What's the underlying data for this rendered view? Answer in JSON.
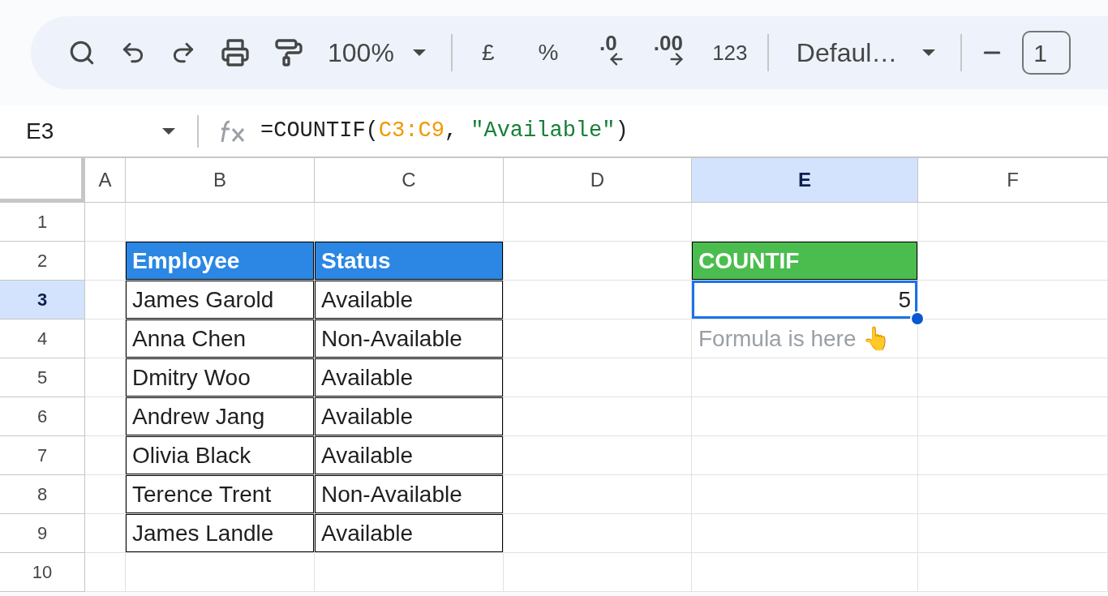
{
  "toolbar": {
    "zoom": "100%",
    "currency": "£",
    "percent": "%",
    "decrease_decimal": ".0",
    "increase_decimal": ".00",
    "more_formats": "123",
    "font": "Defaul…",
    "font_size": "1"
  },
  "formula_bar": {
    "cell_ref": "E3",
    "segments": [
      {
        "kind": "plain",
        "text": "=COUNTIF("
      },
      {
        "kind": "range",
        "text": "C3:C9"
      },
      {
        "kind": "plain",
        "text": ", "
      },
      {
        "kind": "string",
        "text": "\"Available\""
      },
      {
        "kind": "plain",
        "text": ")"
      }
    ]
  },
  "columns": [
    {
      "label": "A",
      "selected": false
    },
    {
      "label": "B",
      "selected": false
    },
    {
      "label": "C",
      "selected": false
    },
    {
      "label": "D",
      "selected": false
    },
    {
      "label": "E",
      "selected": true
    },
    {
      "label": "F",
      "selected": false
    }
  ],
  "row_headers": [
    {
      "label": "1",
      "selected": false
    },
    {
      "label": "2",
      "selected": false
    },
    {
      "label": "3",
      "selected": true
    },
    {
      "label": "4",
      "selected": false
    },
    {
      "label": "5",
      "selected": false
    },
    {
      "label": "6",
      "selected": false
    },
    {
      "label": "7",
      "selected": false
    },
    {
      "label": "8",
      "selected": false
    },
    {
      "label": "9",
      "selected": false
    },
    {
      "label": "10",
      "selected": false
    }
  ],
  "employee_table": {
    "headers": [
      "Employee",
      "Status"
    ],
    "rows": [
      {
        "employee": "James Garold",
        "status": "Available"
      },
      {
        "employee": "Anna Chen",
        "status": "Non-Available"
      },
      {
        "employee": "Dmitry Woo",
        "status": "Available"
      },
      {
        "employee": "Andrew Jang",
        "status": "Available"
      },
      {
        "employee": "Olivia Black",
        "status": "Available"
      },
      {
        "employee": "Terence Trent",
        "status": "Non-Available"
      },
      {
        "employee": "James Landle",
        "status": "Available"
      }
    ]
  },
  "countif_block": {
    "header": "COUNTIF",
    "result": "5",
    "selected": true,
    "note": "Formula is here 👆"
  }
}
